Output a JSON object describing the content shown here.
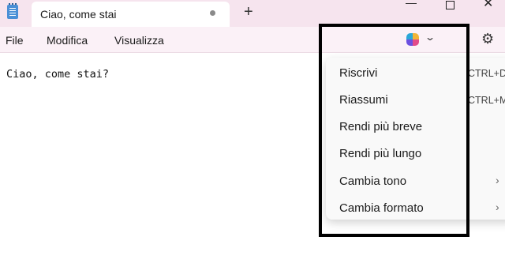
{
  "tab": {
    "title": "Ciao, come stai"
  },
  "menubar": {
    "file": "File",
    "edit": "Modifica",
    "view": "Visualizza"
  },
  "editor": {
    "text": "Ciao, come stai?"
  },
  "controls": {
    "new_tab": "+",
    "minimize": "—",
    "close": "✕",
    "gear": "⚙",
    "chevron": "⌄"
  },
  "copilot_menu": {
    "items": [
      {
        "label": "Riscrivi",
        "shortcut": "CTRL+D"
      },
      {
        "label": "Riassumi",
        "shortcut": "CTRL+M"
      },
      {
        "label": "Rendi più breve"
      },
      {
        "label": "Rendi più lungo"
      },
      {
        "label": "Cambia tono",
        "arrow": "›"
      },
      {
        "label": "Cambia formato",
        "arrow": "›"
      }
    ]
  },
  "colors": {
    "titlebar": "#f6e4ee",
    "menubar": "#fbf1f7",
    "highlight": "#000000"
  },
  "icons": {
    "app": "notepad-icon",
    "copilot": "copilot-icon",
    "settings": "gear-icon"
  }
}
